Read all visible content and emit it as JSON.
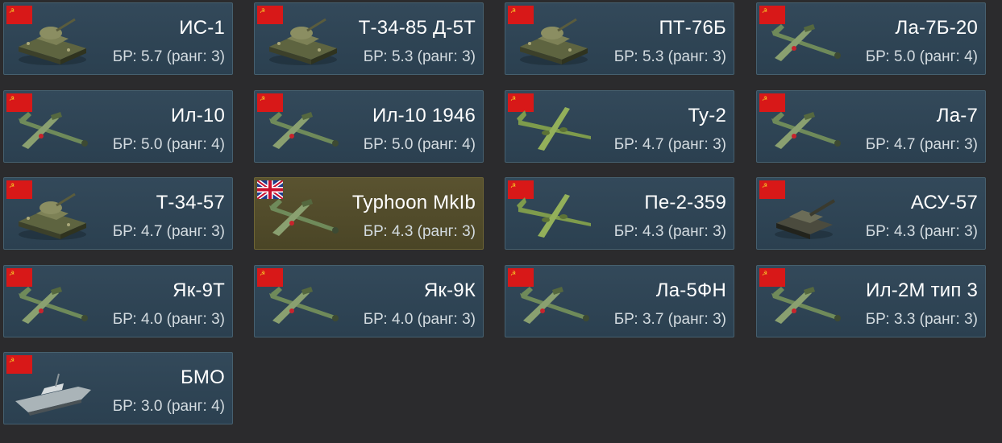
{
  "labels": {
    "br_prefix": "БР:",
    "rank_prefix": "ранг:"
  },
  "colors": {
    "card_ussr": "#2f4556",
    "card_uk": "#524b2a",
    "flag_red": "#d81818"
  },
  "vehicles": [
    {
      "name": "ИС-1",
      "flag": "ussr",
      "type": "tank",
      "sub": "БР: 5.7 (ранг: 3)",
      "br": "5.7",
      "rank": "3",
      "icon": "tank-icon"
    },
    {
      "name": "Т-34-85 Д-5Т",
      "flag": "ussr",
      "type": "tank",
      "sub": "БР: 5.3 (ранг: 3)",
      "br": "5.3",
      "rank": "3",
      "icon": "tank-icon"
    },
    {
      "name": "ПТ-76Б",
      "flag": "ussr",
      "type": "tank",
      "sub": "БР: 5.3 (ранг: 3)",
      "br": "5.3",
      "rank": "3",
      "icon": "tank-icon"
    },
    {
      "name": "Ла-7Б-20",
      "flag": "ussr",
      "type": "plane",
      "sub": "БР: 5.0 (ранг: 4)",
      "br": "5.0",
      "rank": "4",
      "icon": "aircraft-icon"
    },
    {
      "name": "Ил-10",
      "flag": "ussr",
      "type": "plane",
      "sub": "БР: 5.0 (ранг: 4)",
      "br": "5.0",
      "rank": "4",
      "icon": "aircraft-icon"
    },
    {
      "name": "Ил-10 1946",
      "flag": "ussr",
      "type": "plane",
      "sub": "БР: 5.0 (ранг: 4)",
      "br": "5.0",
      "rank": "4",
      "icon": "aircraft-icon"
    },
    {
      "name": "Ту-2",
      "flag": "ussr",
      "type": "bomber",
      "sub": "БР: 4.7 (ранг: 3)",
      "br": "4.7",
      "rank": "3",
      "icon": "bomber-icon"
    },
    {
      "name": "Ла-7",
      "flag": "ussr",
      "type": "plane",
      "sub": "БР: 4.7 (ранг: 3)",
      "br": "4.7",
      "rank": "3",
      "icon": "aircraft-icon"
    },
    {
      "name": "Т-34-57",
      "flag": "ussr",
      "type": "tank",
      "sub": "БР: 4.7 (ранг: 3)",
      "br": "4.7",
      "rank": "3",
      "icon": "tank-icon"
    },
    {
      "name": "Typhoon MkIb",
      "flag": "uk",
      "type": "plane",
      "sub": "БР: 4.3 (ранг: 3)",
      "br": "4.3",
      "rank": "3",
      "icon": "aircraft-icon"
    },
    {
      "name": "Пе-2-359",
      "flag": "ussr",
      "type": "bomber",
      "sub": "БР: 4.3 (ранг: 3)",
      "br": "4.3",
      "rank": "3",
      "icon": "bomber-icon"
    },
    {
      "name": "АСУ-57",
      "flag": "ussr",
      "type": "spg",
      "sub": "БР: 4.3 (ранг: 3)",
      "br": "4.3",
      "rank": "3",
      "icon": "spg-icon"
    },
    {
      "name": "Як-9Т",
      "flag": "ussr",
      "type": "plane",
      "sub": "БР: 4.0 (ранг: 3)",
      "br": "4.0",
      "rank": "3",
      "icon": "aircraft-icon"
    },
    {
      "name": "Як-9К",
      "flag": "ussr",
      "type": "plane",
      "sub": "БР: 4.0 (ранг: 3)",
      "br": "4.0",
      "rank": "3",
      "icon": "aircraft-icon"
    },
    {
      "name": "Ла-5ФН",
      "flag": "ussr",
      "type": "plane",
      "sub": "БР: 3.7 (ранг: 3)",
      "br": "3.7",
      "rank": "3",
      "icon": "aircraft-icon"
    },
    {
      "name": "Ил-2М тип 3",
      "flag": "ussr",
      "type": "plane",
      "sub": "БР: 3.3 (ранг: 3)",
      "br": "3.3",
      "rank": "3",
      "icon": "aircraft-icon"
    },
    {
      "name": "БМО",
      "flag": "ussr",
      "type": "boat",
      "sub": "БР: 3.0 (ранг: 4)",
      "br": "3.0",
      "rank": "4",
      "icon": "boat-icon"
    }
  ]
}
